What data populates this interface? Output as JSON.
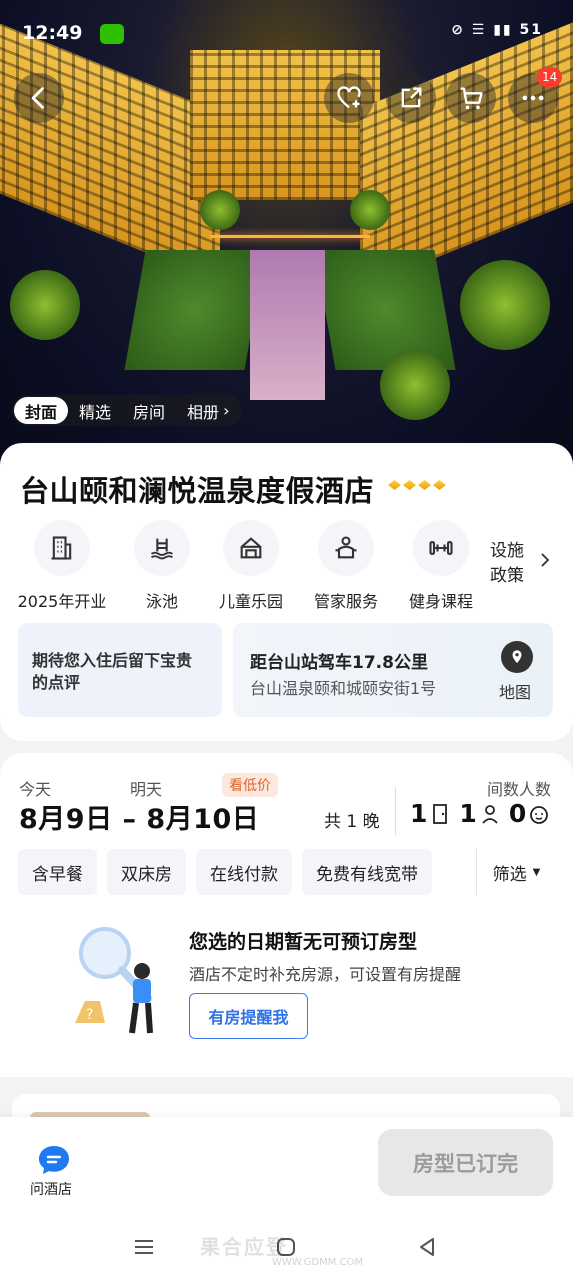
{
  "status_bar": {
    "time": "12:49",
    "right": "⊘ ☰ ▮▮ 51"
  },
  "header": {
    "cart_badge": "14"
  },
  "gallery_tabs": [
    "封面",
    "精选",
    "房间",
    "相册"
  ],
  "hotel": {
    "name": "台山颐和澜悦温泉度假酒店",
    "rating_diamonds": 4,
    "facilities": [
      {
        "label": "2025年开业",
        "icon": "building-icon"
      },
      {
        "label": "泳池",
        "icon": "pool-icon"
      },
      {
        "label": "儿童乐园",
        "icon": "playground-icon"
      },
      {
        "label": "管家服务",
        "icon": "butler-icon"
      },
      {
        "label": "健身课程",
        "icon": "dumbbell-icon"
      }
    ],
    "policy_line1": "设施",
    "policy_line2": "政策",
    "review_prompt_line1": "期待您入住后留下宝贵",
    "review_prompt_line2": "的点评",
    "distance": "距台山站驾车17.8公里",
    "address": "台山温泉颐和城颐安街1号",
    "map_label": "地图"
  },
  "booking": {
    "checkin_label": "今天",
    "checkout_label": "明天",
    "low_price_tag": "看低价",
    "dates": "8月9日 – 8月10日",
    "nights": "共 1 晚",
    "guests_label": "间数人数",
    "rooms": "1",
    "adults": "1",
    "children": "0",
    "chips": [
      "含早餐",
      "双床房",
      "在线付款",
      "免费有线宽带"
    ],
    "filter_label": "筛选",
    "empty_title": "您选的日期暂无可预订房型",
    "empty_sub": "酒店不定时补充房源，可设置有房提醒",
    "remind_button": "有房提醒我"
  },
  "bottom": {
    "ask_label": "问酒店",
    "sold_out_label": "房型已订完"
  },
  "watermark": {
    "text": "果合应登",
    "url": "WWW.GDMM.COM"
  },
  "colors": {
    "accent_blue": "#2f72e8",
    "diamond_gold": "#f1a000",
    "badge_red": "#ff3b30"
  }
}
